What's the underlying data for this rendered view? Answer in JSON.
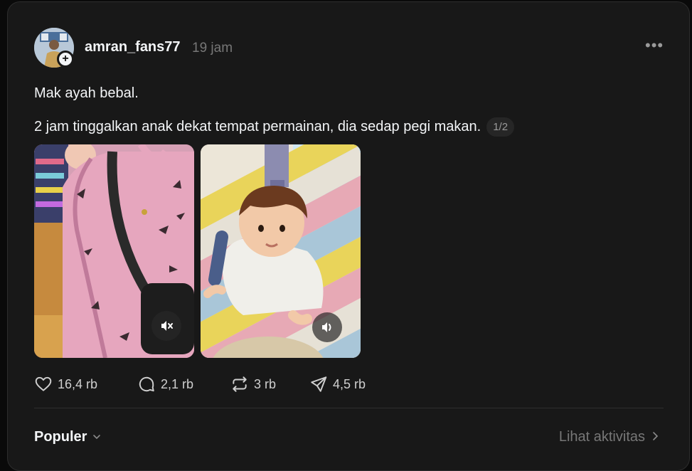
{
  "post": {
    "username": "amran_fans77",
    "time": "19 jam",
    "text_line1": "Mak ayah bebal.",
    "text_line2": "2 jam tinggalkan anak dekat tempat permainan, dia sedap pegi makan.",
    "page_indicator": "1/2",
    "media": [
      {
        "type": "video",
        "sound": "muted",
        "icon": "speaker-muted-icon"
      },
      {
        "type": "video",
        "sound": "on",
        "icon": "speaker-icon"
      }
    ]
  },
  "actions": {
    "likes": "16,4 rb",
    "replies": "2,1 rb",
    "reposts": "3 rb",
    "shares": "4,5 rb"
  },
  "footer": {
    "sort_label": "Populer",
    "activity_label": "Lihat aktivitas"
  },
  "colors": {
    "background": "#181818",
    "text": "#f3f5f7",
    "muted": "#777777"
  }
}
